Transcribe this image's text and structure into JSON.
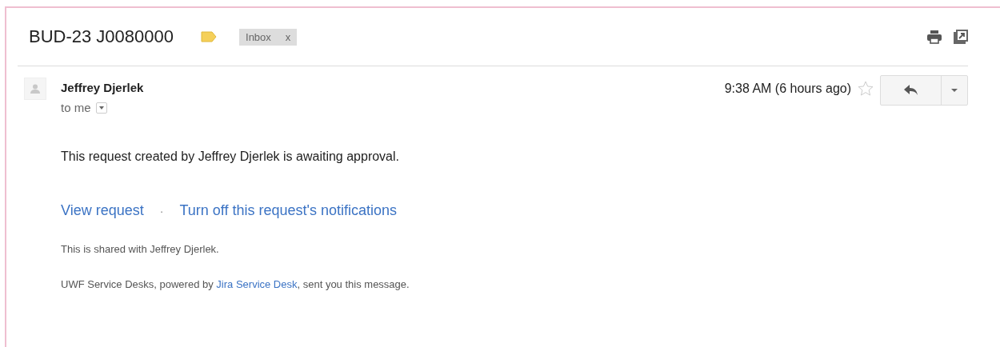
{
  "subject": {
    "title": "BUD-23 J0080000",
    "labels": [
      {
        "name": "Inbox",
        "remove": "x"
      }
    ]
  },
  "message": {
    "sender": "Jeffrey Djerlek",
    "recipient": "to me",
    "time": "9:38 AM (6 hours ago)",
    "starred": false,
    "body": "This request created by Jeffrey Djerlek is awaiting approval.",
    "links": [
      "View request",
      "Turn off this request's notifications"
    ],
    "separator": "·",
    "shared": "This is shared with Jeffrey Djerlek.",
    "footer": {
      "before": "UWF Service Desks, powered by ",
      "link": "Jira Service Desk",
      "after": ", sent you this message."
    }
  }
}
